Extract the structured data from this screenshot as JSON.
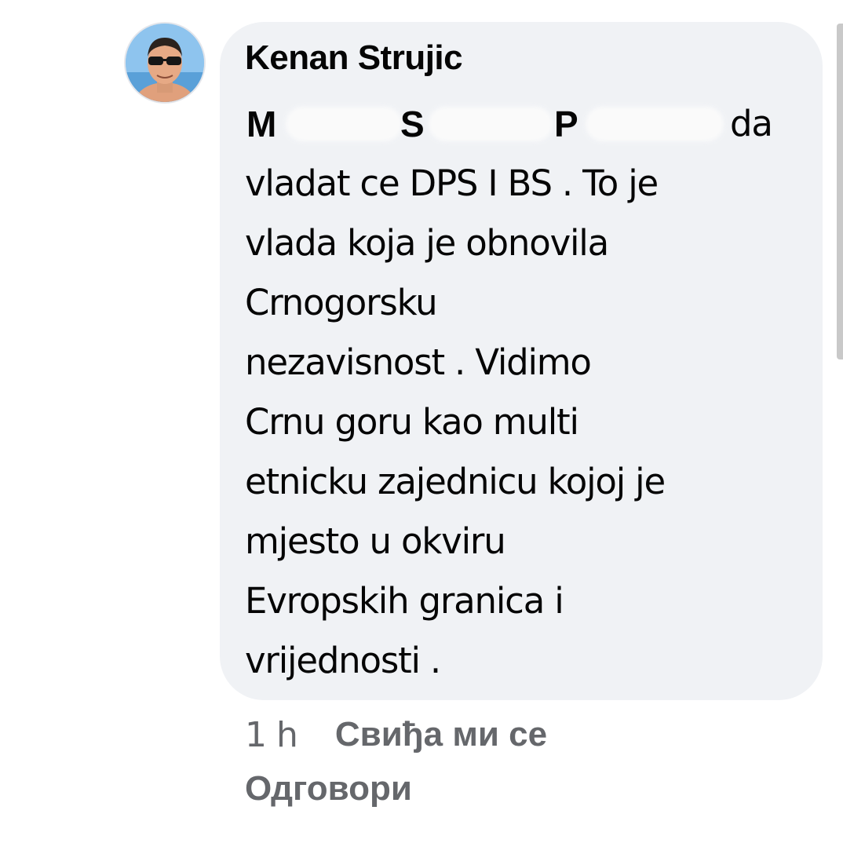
{
  "comment": {
    "author": {
      "name": "Kenan Strujic",
      "avatar_icon": "profile-photo"
    },
    "first_line": {
      "word1": "M",
      "word2": "S",
      "word3": "P",
      "word4": "da"
    },
    "body_lines": [
      "vladat ce DPS I BS . To je",
      "vlada koja je obnovila",
      "Crnogorsku",
      "nezavisnost . Vidimo",
      "Crnu goru kao multi",
      "etnicku zajednicu kojoj je",
      "mjesto u okviru",
      "Evropskih granica i",
      "vrijednosti ."
    ],
    "timestamp": "1 h",
    "like_label": "Свиђа ми се",
    "reply_label": "Одговори"
  },
  "colors": {
    "bubble_background": "#f0f2f5",
    "text_primary": "#050505",
    "text_secondary": "#65676b"
  }
}
